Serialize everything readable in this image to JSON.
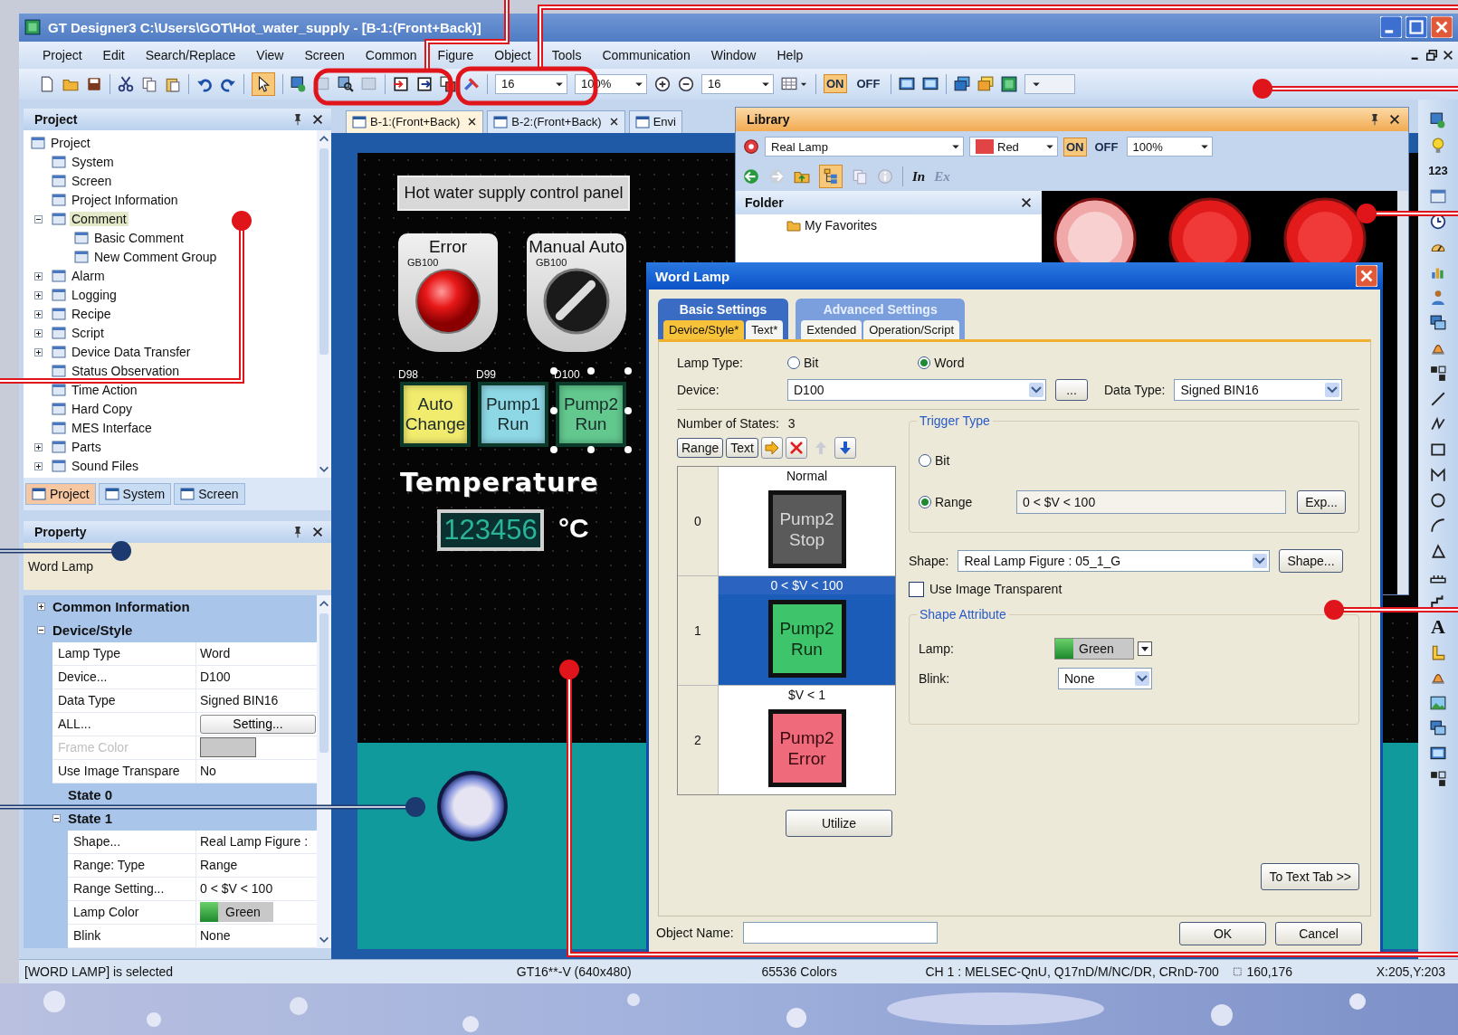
{
  "window": {
    "title": "GT Designer3 C:\\Users\\GOT\\Hot_water_supply - [B-1:(Front+Back)]"
  },
  "menu": [
    "Project",
    "Edit",
    "Search/Replace",
    "View",
    "Screen",
    "Common",
    "Figure",
    "Object",
    "Tools",
    "Communication",
    "Window",
    "Help"
  ],
  "toolbar": {
    "pointer_tool": {
      "selected": true
    },
    "combos": [
      "16",
      "100%",
      "16"
    ],
    "switch": [
      {
        "label": "ON",
        "selected": true
      },
      {
        "label": "OFF",
        "selected": false
      }
    ]
  },
  "project_panel": {
    "title": "Project",
    "tree": [
      {
        "label": "Project",
        "selected": false,
        "children": [
          {
            "label": "System",
            "selected": false
          },
          {
            "label": "Screen",
            "selected": false
          },
          {
            "label": "Project Information",
            "selected": false
          },
          {
            "label": "Comment",
            "selected": true,
            "expanded": true,
            "children": [
              {
                "label": "Basic Comment",
                "selected": false
              },
              {
                "label": "New Comment Group",
                "selected": false
              }
            ]
          },
          {
            "label": "Alarm",
            "selected": false,
            "expanded": false
          },
          {
            "label": "Logging",
            "selected": false,
            "expanded": false
          },
          {
            "label": "Recipe",
            "selected": false,
            "expanded": false
          },
          {
            "label": "Script",
            "selected": false,
            "expanded": false
          },
          {
            "label": "Device Data Transfer",
            "selected": false,
            "expanded": false
          },
          {
            "label": "Status Observation",
            "selected": false
          },
          {
            "label": "Time Action",
            "selected": false
          },
          {
            "label": "Hard Copy",
            "selected": false
          },
          {
            "label": "MES Interface",
            "selected": false
          },
          {
            "label": "Parts",
            "selected": false,
            "expanded": false
          },
          {
            "label": "Sound Files",
            "selected": false,
            "expanded": false
          }
        ]
      }
    ],
    "tabs": [
      {
        "label": "Project",
        "selected": true
      },
      {
        "label": "System",
        "selected": false
      },
      {
        "label": "Screen",
        "selected": false
      }
    ]
  },
  "property_panel": {
    "title": "Property",
    "object": "Word Lamp",
    "rows": [
      {
        "kind": "category",
        "label": "Common Information",
        "expanded": false
      },
      {
        "kind": "category",
        "label": "Device/Style",
        "expanded": true,
        "children": [
          {
            "kind": "value",
            "label": "Lamp Type",
            "value": "Word",
            "disabled": false
          },
          {
            "kind": "value",
            "label": "Device...",
            "value": "D100",
            "disabled": false
          },
          {
            "kind": "value",
            "label": "Data Type",
            "value": "Signed BIN16",
            "disabled": false
          },
          {
            "kind": "button",
            "label": "ALL...",
            "value": "Setting...",
            "disabled": false
          },
          {
            "kind": "swatch",
            "label": "Frame Color",
            "disabled": true
          },
          {
            "kind": "value",
            "label": "Use Image Transpare",
            "value": "No",
            "disabled": false
          },
          {
            "kind": "category",
            "label": "State 0"
          },
          {
            "kind": "category",
            "label": "State 1",
            "expanded": true,
            "children": [
              {
                "kind": "value",
                "label": "Shape...",
                "value": "Real Lamp Figure :",
                "disabled": false
              },
              {
                "kind": "value",
                "label": "Range: Type",
                "value": "Range",
                "disabled": false
              },
              {
                "kind": "value",
                "label": "Range Setting...",
                "value": "0 < $V < 100",
                "disabled": false
              },
              {
                "kind": "color",
                "label": "Lamp Color",
                "value": "Green",
                "disabled": false
              },
              {
                "kind": "value",
                "label": "Blink",
                "value": "None",
                "disabled": false
              }
            ]
          }
        ]
      }
    ]
  },
  "editor": {
    "tabs": [
      {
        "label": "B-1:(Front+Back)",
        "selected": true
      },
      {
        "label": "B-2:(Front+Back)",
        "selected": false
      },
      {
        "label": "Envi",
        "selected": false
      }
    ],
    "screen": {
      "title": "Hot water supply control panel",
      "switches": [
        {
          "label": "Error",
          "device": "GB100",
          "kind": "lamp"
        },
        {
          "label": "Manual Auto",
          "device": "GB100",
          "kind": "selector"
        }
      ],
      "lamps": [
        {
          "device": "D98",
          "text": "Auto Change",
          "color": "#f2ec6e",
          "selected": false
        },
        {
          "device": "D99",
          "text": "Pump1 Run",
          "color": "#8ed8e6",
          "selected": false
        },
        {
          "device": "D100",
          "text": "Pump2 Run",
          "color": "#62c88e",
          "selected": true
        }
      ],
      "heading": "Temperature",
      "numeric": "123456",
      "unit": "°C"
    }
  },
  "library": {
    "title": "Library",
    "category": "Real Lamp",
    "color_name": "Red",
    "switch": [
      {
        "label": "ON",
        "selected": true
      },
      {
        "label": "OFF",
        "selected": false
      }
    ],
    "scale": "100%",
    "tree_view": {
      "selected": true
    },
    "import": "In",
    "export": "Ex",
    "folder_title": "Folder",
    "folders": [
      "My Favorites"
    ]
  },
  "dialog": {
    "title": "Word Lamp",
    "tab_groups": [
      {
        "label": "Basic Settings",
        "selected": true,
        "tabs": [
          {
            "label": "Device/Style*",
            "selected": true
          },
          {
            "label": "Text*",
            "selected": false
          }
        ]
      },
      {
        "label": "Advanced Settings",
        "selected": false,
        "tabs": [
          {
            "label": "Extended",
            "selected": false
          },
          {
            "label": "Operation/Script",
            "selected": false
          }
        ]
      }
    ],
    "lamp_type": {
      "label": "Lamp Type:",
      "options": [
        {
          "label": "Bit",
          "selected": false
        },
        {
          "label": "Word",
          "selected": true
        }
      ]
    },
    "device": {
      "label": "Device:",
      "value": "D100",
      "browse": "..."
    },
    "data_type": {
      "label": "Data Type:",
      "value": "Signed BIN16"
    },
    "states_count": {
      "label": "Number of States:",
      "value": "3"
    },
    "state_buttons": [
      "Range",
      "Text"
    ],
    "states": [
      {
        "index": "0",
        "condition": "Normal",
        "text": "Pump2 Stop",
        "kind": "stop",
        "selected": false
      },
      {
        "index": "1",
        "condition": "0 < $V < 100",
        "text": "Pump2 Run",
        "kind": "run",
        "selected": true
      },
      {
        "index": "2",
        "condition": "$V < 1",
        "text": "Pump2 Error",
        "kind": "error",
        "selected": false
      }
    ],
    "trigger": {
      "title": "Trigger Type",
      "options": [
        {
          "label": "Bit",
          "selected": false
        },
        {
          "label": "Range",
          "selected": true
        }
      ],
      "range": "0 < $V < 100",
      "button": "Exp..."
    },
    "shape": {
      "label": "Shape:",
      "value": "Real Lamp Figure : 05_1_G",
      "button": "Shape..."
    },
    "transparent": {
      "label": "Use Image Transparent",
      "checked": false
    },
    "attribute": {
      "title": "Shape Attribute",
      "lamp_label": "Lamp:",
      "lamp": "Green",
      "blink_label": "Blink:",
      "blink": "None"
    },
    "utilize": "Utilize",
    "to_text": "To Text Tab >>",
    "object_name": {
      "label": "Object Name:"
    },
    "ok": "OK",
    "cancel": "Cancel"
  },
  "right_toolbar": {
    "numeric": "123",
    "text": "A"
  },
  "status_bar": [
    "[WORD LAMP] is selected",
    "GT16**-V (640x480)",
    "65536 Colors",
    "CH 1 : MELSEC-QnU, Q17nD/M/NC/DR, CRnD-700",
    "160,176",
    "X:205,Y:203"
  ]
}
